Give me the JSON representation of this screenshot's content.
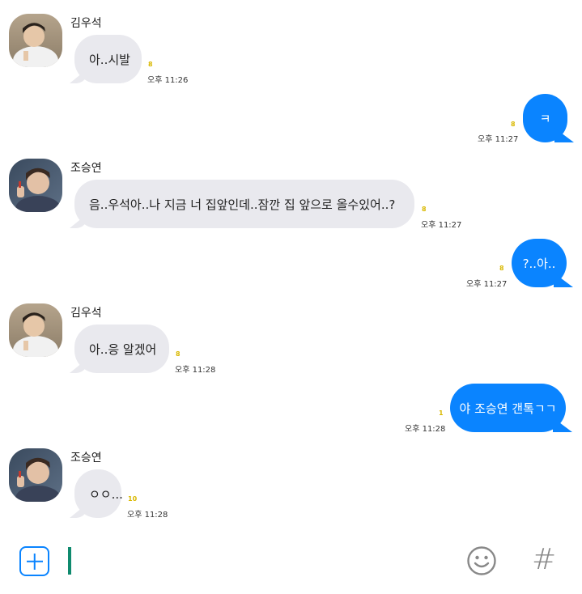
{
  "messages": [
    {
      "sender": "김우석",
      "text": "아..시발",
      "unread": "8",
      "time": "오후 11:26"
    },
    {
      "text": "ㅋ",
      "unread": "8",
      "time": "오후 11:27"
    },
    {
      "sender": "조승연",
      "text": "음..우석아..나 지금 너 집앞인데..잠깐 집 앞으로 올수있어..?",
      "unread": "8",
      "time": "오후 11:27"
    },
    {
      "text": "?..아..",
      "unread": "8",
      "time": "오후 11:27"
    },
    {
      "sender": "김우석",
      "text": "아..응 알겠어",
      "unread": "8",
      "time": "오후 11:28"
    },
    {
      "text": "야 조승연 갠톡ㄱㄱ",
      "unread": "1",
      "time": "오후 11:28"
    },
    {
      "sender": "조승연",
      "text": "ㅇㅇ...",
      "unread": "10",
      "time": "오후 11:28"
    }
  ],
  "input": {
    "plus_icon": "plus-icon",
    "emoji_icon": "emoji-icon",
    "hash_symbol": "#"
  },
  "colors": {
    "outgoing": "#0a84ff",
    "incoming": "#e9e9ee",
    "unread": "#d9b800",
    "cursor": "#0f8a6e"
  }
}
